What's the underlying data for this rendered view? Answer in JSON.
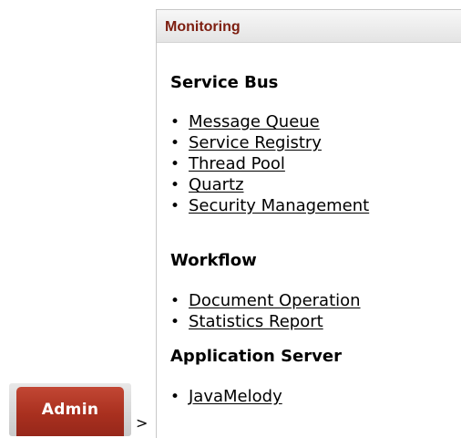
{
  "breadcrumb": {
    "admin_tab_label": "Admin",
    "separator": ">"
  },
  "panel": {
    "title": "Monitoring",
    "sections": [
      {
        "heading": "Service Bus",
        "links": [
          "Message Queue",
          "Service Registry",
          "Thread Pool",
          "Quartz",
          "Security Management"
        ]
      },
      {
        "heading": "Workflow",
        "links": [
          "Document Operation",
          "Statistics Report"
        ]
      },
      {
        "heading": "Application Server",
        "links": [
          "JavaMelody"
        ]
      }
    ]
  },
  "colors": {
    "admin_tab_red": "#a9301f",
    "panel_title": "#7d1e10"
  }
}
